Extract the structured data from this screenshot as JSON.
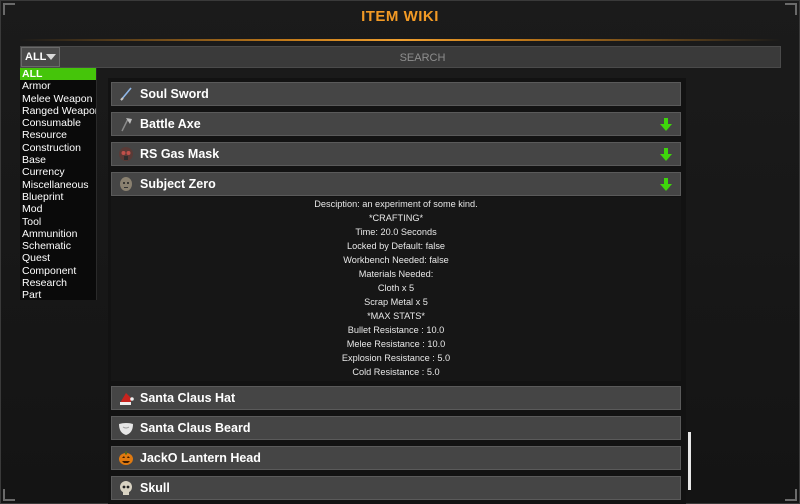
{
  "window": {
    "title": "ITEM WIKI"
  },
  "filter": {
    "selected": "ALL"
  },
  "search": {
    "placeholder": "SEARCH",
    "value": ""
  },
  "categories": [
    "ALL",
    "Armor",
    "Melee Weapon",
    "Ranged Weapon",
    "Consumable",
    "Resource",
    "Construction",
    "Base",
    "Currency",
    "Miscellaneous",
    "Blueprint",
    "Mod",
    "Tool",
    "Ammunition",
    "Schematic",
    "Quest",
    "Component",
    "Research",
    "Part"
  ],
  "active_category": "ALL",
  "items": [
    {
      "name": "Soul Sword",
      "icon": "sword-icon",
      "expandable": false
    },
    {
      "name": "Battle Axe",
      "icon": "axe-icon",
      "expandable": true
    },
    {
      "name": "RS Gas Mask",
      "icon": "gas-mask-icon",
      "expandable": true
    },
    {
      "name": "Subject Zero",
      "icon": "head-icon",
      "expandable": true,
      "expanded": true
    },
    {
      "name": "Santa Claus Hat",
      "icon": "santa-hat-icon",
      "expandable": false
    },
    {
      "name": "Santa Claus Beard",
      "icon": "beard-icon",
      "expandable": false
    },
    {
      "name": "JackO Lantern Head",
      "icon": "pumpkin-icon",
      "expandable": false
    },
    {
      "name": "Skull",
      "icon": "skull-icon",
      "expandable": false
    }
  ],
  "details": {
    "description": "Desciption: an experiment of some kind.",
    "crafting_header": "*CRAFTING*",
    "time": "Time: 20.0 Seconds",
    "locked": "Locked by Default: false",
    "workbench": "Workbench Needed: false",
    "materials_header": "Materials Needed:",
    "material_1": "Cloth x 5",
    "material_2": "Scrap Metal x 5",
    "stats_header": "*MAX STATS*",
    "stat_1": "Bullet Resistance : 10.0",
    "stat_2": "Melee Resistance : 10.0",
    "stat_3": "Explosion Resistance : 5.0",
    "stat_4": "Cold Resistance : 5.0"
  },
  "colors": {
    "accent": "#f29a25",
    "active": "#45c50a",
    "arrow": "#3fd40c"
  }
}
